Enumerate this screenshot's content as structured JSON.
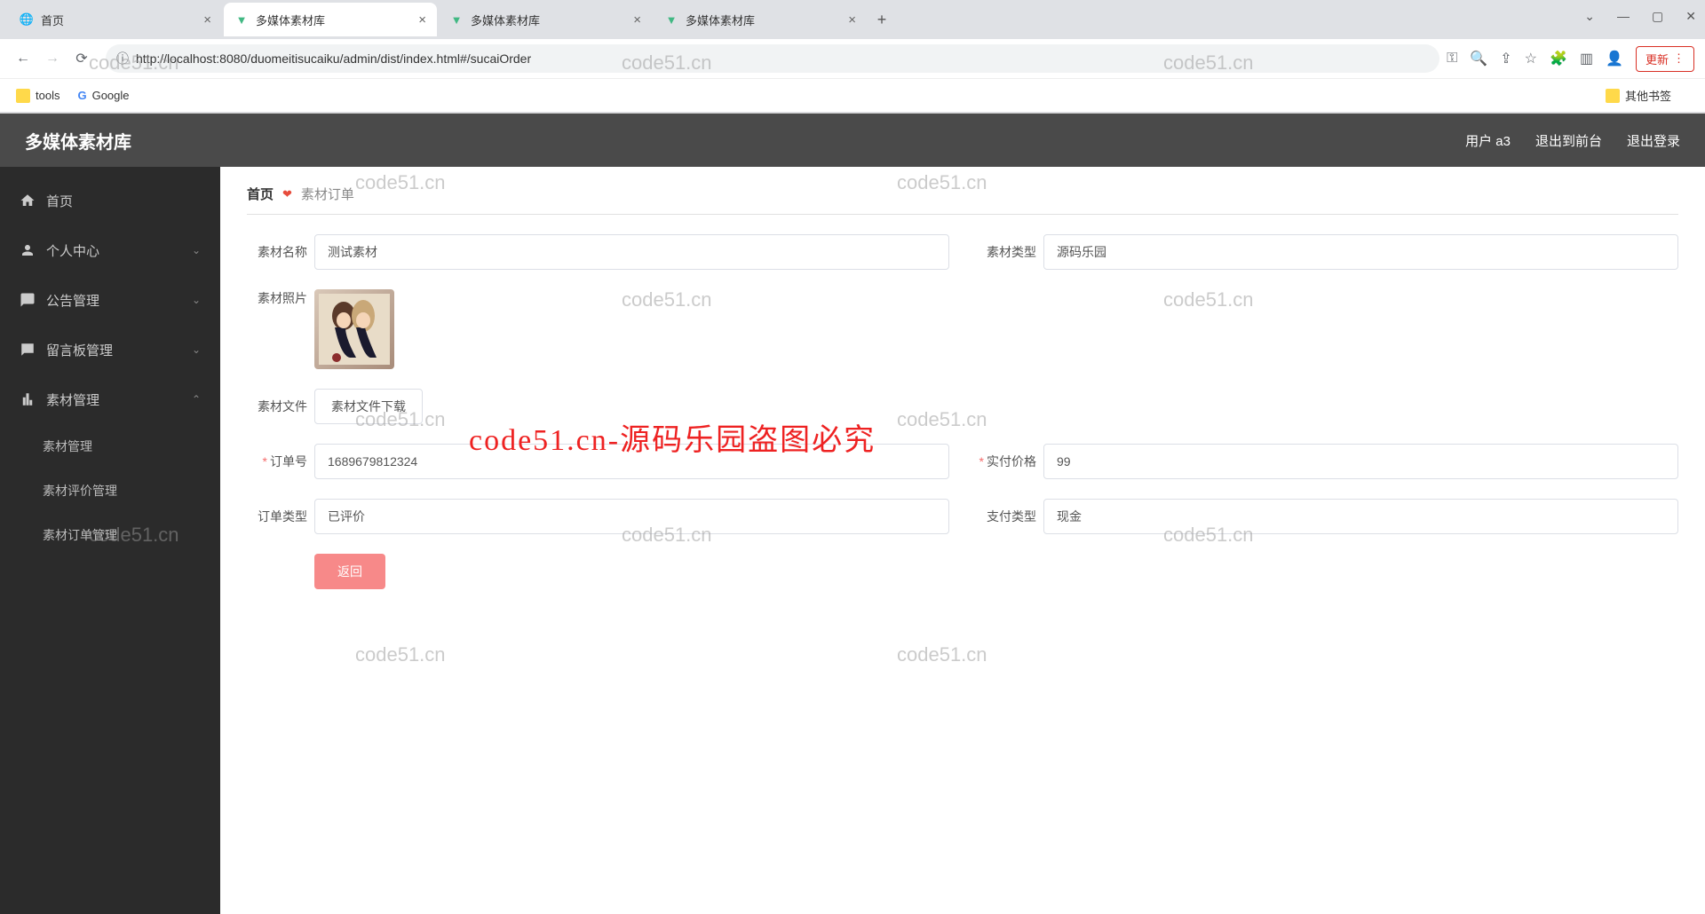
{
  "browser": {
    "tabs": [
      {
        "title": "首页",
        "favicon": "globe"
      },
      {
        "title": "多媒体素材库",
        "favicon": "vue",
        "active": true
      },
      {
        "title": "多媒体素材库",
        "favicon": "vue"
      },
      {
        "title": "多媒体素材库",
        "favicon": "vue"
      }
    ],
    "url": "http://localhost:8080/duomeitisucaiku/admin/dist/index.html#/sucaiOrder",
    "update_btn": "更新",
    "bookmarks": [
      {
        "label": "tools"
      },
      {
        "label": "Google",
        "icon": "g"
      }
    ],
    "other_bookmarks": "其他书签"
  },
  "app": {
    "title": "多媒体素材库",
    "header_right": {
      "user": "用户 a3",
      "logout_front": "退出到前台",
      "logout": "退出登录"
    }
  },
  "sidebar": {
    "items": [
      {
        "label": "首页",
        "icon": "home"
      },
      {
        "label": "个人中心",
        "icon": "user",
        "expandable": true
      },
      {
        "label": "公告管理",
        "icon": "announce",
        "expandable": true
      },
      {
        "label": "留言板管理",
        "icon": "board",
        "expandable": true
      },
      {
        "label": "素材管理",
        "icon": "chart",
        "expandable": true,
        "expanded": true
      }
    ],
    "sub_items": [
      "素材管理",
      "素材评价管理",
      "素材订单管理"
    ]
  },
  "breadcrumb": {
    "home": "首页",
    "current": "素材订单"
  },
  "form": {
    "material_name": {
      "label": "素材名称",
      "value": "测试素材"
    },
    "material_type": {
      "label": "素材类型",
      "value": "源码乐园"
    },
    "material_photo": {
      "label": "素材照片"
    },
    "material_file": {
      "label": "素材文件",
      "button": "素材文件下载"
    },
    "order_no": {
      "label": "订单号",
      "value": "1689679812324"
    },
    "actual_price": {
      "label": "实付价格",
      "value": "99"
    },
    "order_type": {
      "label": "订单类型",
      "value": "已评价"
    },
    "pay_type": {
      "label": "支付类型",
      "value": "现金"
    },
    "back_button": "返回"
  },
  "watermarks": {
    "text": "code51.cn",
    "red_text": "code51.cn-源码乐园盗图必究"
  }
}
